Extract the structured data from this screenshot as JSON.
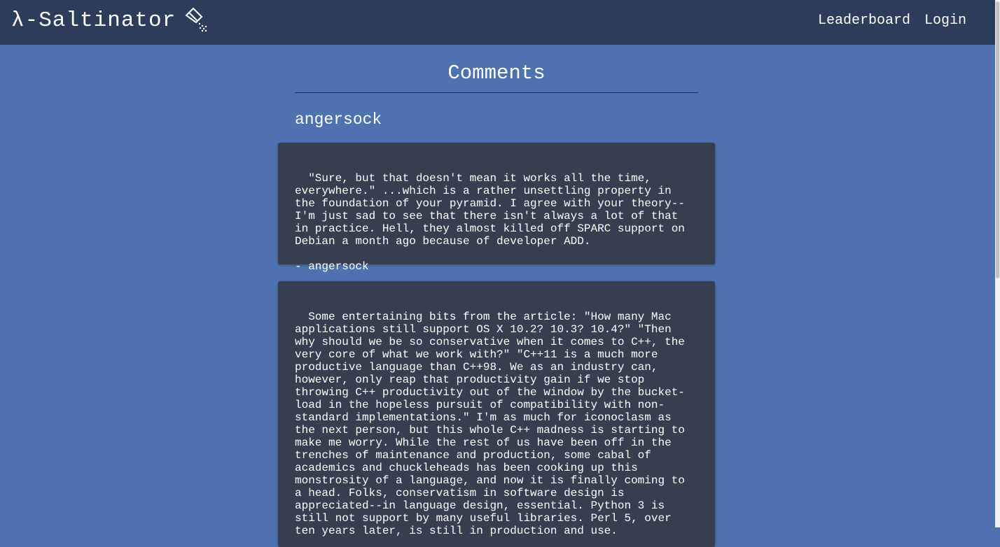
{
  "navbar": {
    "brand": "λ-Saltinator",
    "brand_icon": "salt-shaker-icon",
    "links": [
      "Leaderboard",
      "Login"
    ]
  },
  "page": {
    "title": "Comments",
    "username": "angersock"
  },
  "comments": [
    {
      "text": "\"Sure, but that doesn't mean it works all the time, everywhere.\" ...which is a rather unsettling property in the foundation of your pyramid. I agree with your theory--I'm just sad to see that there isn't always a lot of that in practice. Hell, they almost killed off SPARC support on Debian a month ago because of developer ADD.",
      "signature": "- angersock"
    },
    {
      "text": "Some entertaining bits from the article: \"How many Mac applications still support OS X 10.2? 10.3? 10.4?\" \"Then why should we be so conservative when it comes to C++, the very core of what we work with?\" \"C++11 is a much more productive language than C++98. We as an industry can, however, only reap that productivity gain if we stop throwing C++ productivity out of the window by the bucket-load in the hopeless pursuit of compatibility with non-standard implementations.\" I'm as much for iconoclasm as the next person, but this whole C++ madness is starting to make me worry. While the rest of us have been off in the trenches of maintenance and production, some cabal of academics and chuckleheads has been cooking up this monstrosity of a language, and now it is finally coming to a head. Folks, conservatism in software design is appreciated--in language design, essential. Python 3 is still not support by many useful libraries. Perl 5, over ten years later, is still in production and use.",
      "signature": ""
    }
  ]
}
